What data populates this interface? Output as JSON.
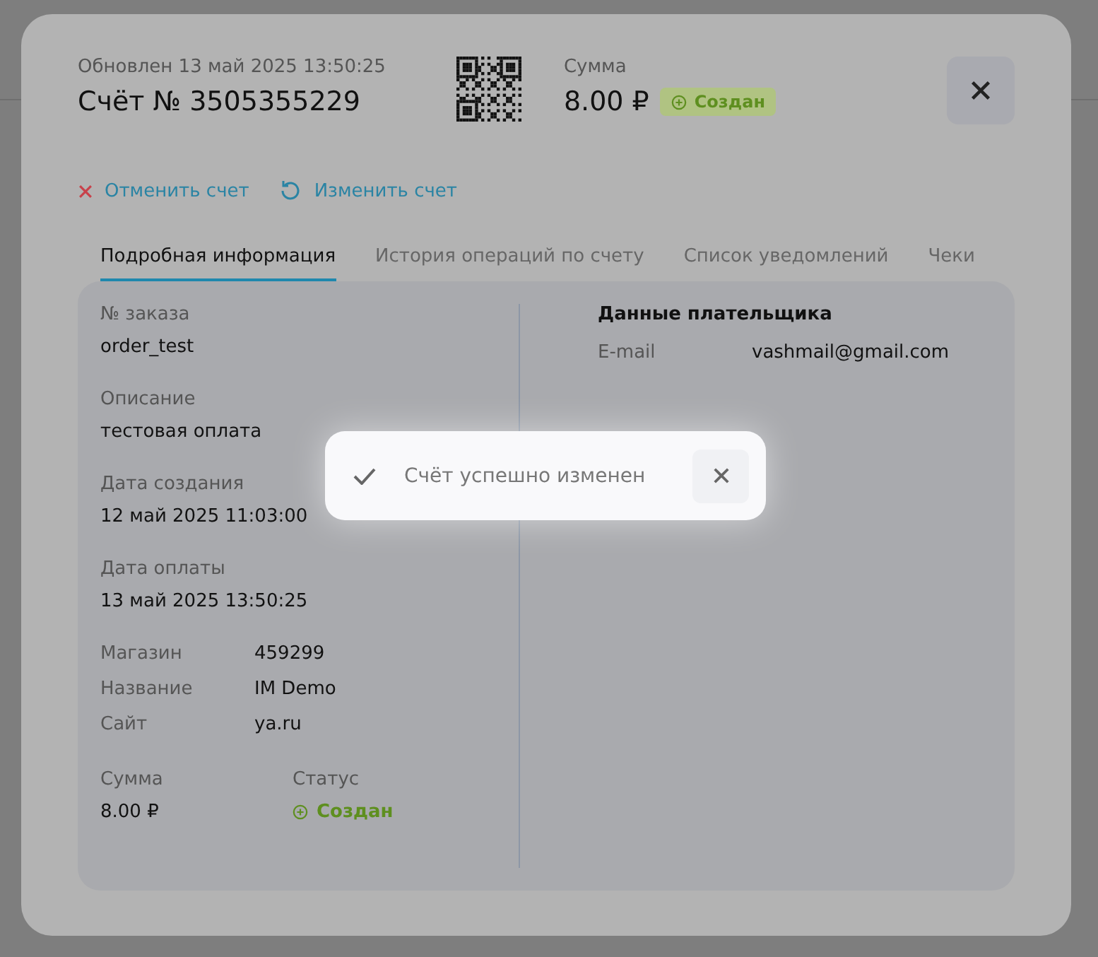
{
  "invoice": {
    "updated": "Обновлен 13 май 2025 13:50:25",
    "title": "Счёт № 3505355229",
    "amount_label": "Сумма",
    "amount": "8.00 ₽",
    "status": {
      "label": "Создан",
      "kind": "created"
    }
  },
  "actions": [
    {
      "label": "Отменить счет",
      "kind": "cancel"
    },
    {
      "label": "Изменить счет",
      "kind": "edit"
    }
  ],
  "tabs": [
    {
      "label": "Подробная информация",
      "selected": true
    },
    {
      "label": "История операций по счету",
      "selected": false
    },
    {
      "label": "Список уведомлений",
      "selected": false
    },
    {
      "label": "Чеки",
      "selected": false
    }
  ],
  "details": {
    "stacked": [
      {
        "label": "№ заказа",
        "value": "order_test"
      },
      {
        "label": "Описание",
        "value": "тестовая оплата"
      },
      {
        "label": "Дата создания",
        "value": "12 май 2025 11:03:00"
      },
      {
        "label": "Дата оплаты",
        "value": "13 май 2025 13:50:25"
      }
    ],
    "pairs": [
      {
        "label": "Магазин",
        "value": "459299"
      },
      {
        "label": "Название",
        "value": "IM Demo"
      },
      {
        "label": "Сайт",
        "value": "ya.ru"
      }
    ],
    "amount": {
      "label": "Сумма",
      "value": "8.00 ₽"
    },
    "status": {
      "label": "Статус",
      "value": "Создан",
      "kind": "created"
    }
  },
  "payer": {
    "title": "Данные плательщика",
    "fields": [
      {
        "label": "E-mail",
        "value": "vashmail@gmail.com"
      }
    ]
  },
  "toast": {
    "message": "Счёт успешно изменен"
  }
}
